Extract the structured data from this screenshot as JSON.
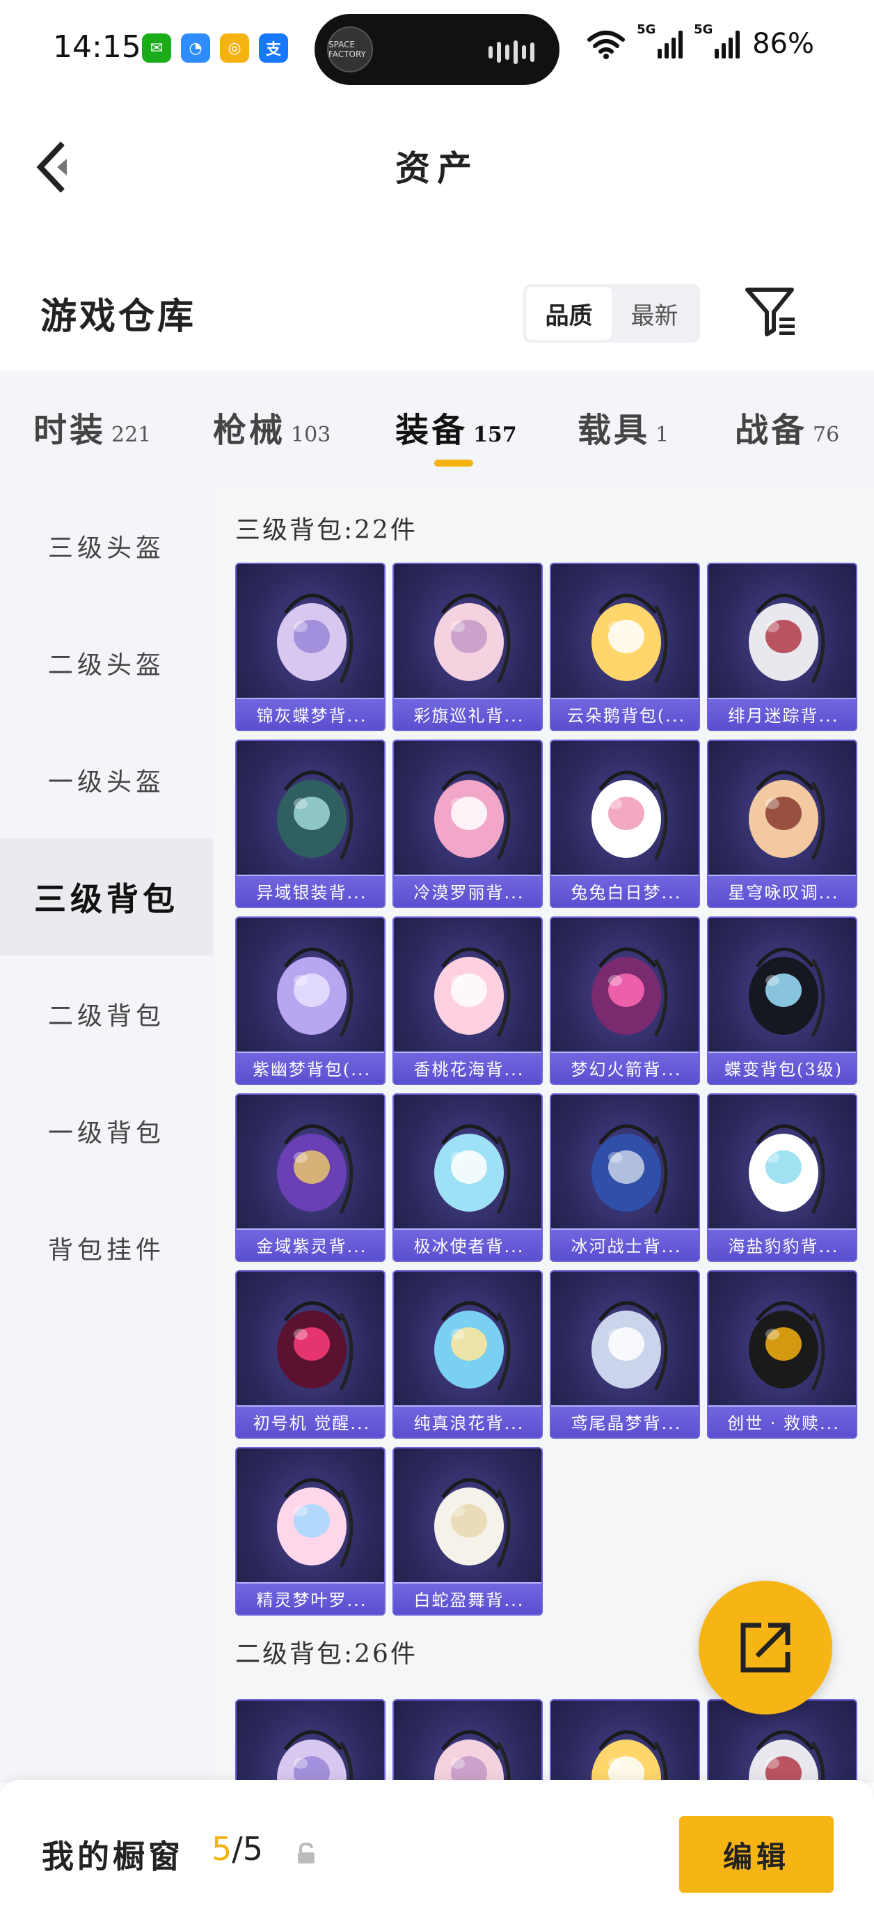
{
  "status_bar": {
    "time": "14:15",
    "battery": "86%",
    "network_1": "5G",
    "network_2": "5G",
    "island_thumb": "SPACE FACTORY",
    "apps": [
      {
        "icon": "wechat-icon",
        "color": "#1aad19",
        "glyph": "✉"
      },
      {
        "icon": "qq-browser-icon",
        "color": "#2e8cff",
        "glyph": "◔"
      },
      {
        "icon": "app-icon",
        "color": "#f5b211",
        "glyph": "◎"
      },
      {
        "icon": "alipay-icon",
        "color": "#1677ff",
        "glyph": "支"
      }
    ]
  },
  "header": {
    "title": "资产"
  },
  "warehouse": {
    "title": "游戏仓库",
    "sort_options": [
      "品质",
      "最新"
    ],
    "active_sort": 0
  },
  "tabs": [
    {
      "label": "时装",
      "count": "221"
    },
    {
      "label": "枪械",
      "count": "103"
    },
    {
      "label": "装备",
      "count": "157"
    },
    {
      "label": "载具",
      "count": "1"
    },
    {
      "label": "战备",
      "count": "76"
    }
  ],
  "active_tab": 2,
  "sidebar": {
    "items": [
      "三级头盔",
      "二级头盔",
      "一级头盔",
      "三级背包",
      "二级背包",
      "一级背包",
      "背包挂件"
    ],
    "active": 3
  },
  "sections": [
    {
      "title": "三级背包:22件",
      "items": [
        "锦灰蝶梦背...",
        "彩旗巡礼背...",
        "云朵鹅背包(...",
        "绯月迷踪背...",
        "异域银装背...",
        "冷漠罗丽背...",
        "兔兔白日梦...",
        "星穹咏叹调...",
        "紫幽梦背包(...",
        "香桃花海背...",
        "梦幻火箭背...",
        "蝶变背包(3级)",
        "金域紫灵背...",
        "极冰使者背...",
        "冰河战士背...",
        "海盐豹豹背...",
        "初号机 觉醒...",
        "纯真浪花背...",
        "鸢尾晶梦背...",
        "创世 · 救赎...",
        "精灵梦叶罗...",
        "白蛇盈舞背..."
      ]
    },
    {
      "title": "二级背包:26件",
      "items": [
        "",
        "",
        "",
        ""
      ]
    }
  ],
  "bottom_bar": {
    "label": "我的橱窗",
    "current": "5",
    "total": "/5",
    "edit_label": "编辑"
  },
  "colors": {
    "accent": "#f5b211",
    "card_label": "#6b60dc",
    "card_bg": "#2c2a5e"
  }
}
